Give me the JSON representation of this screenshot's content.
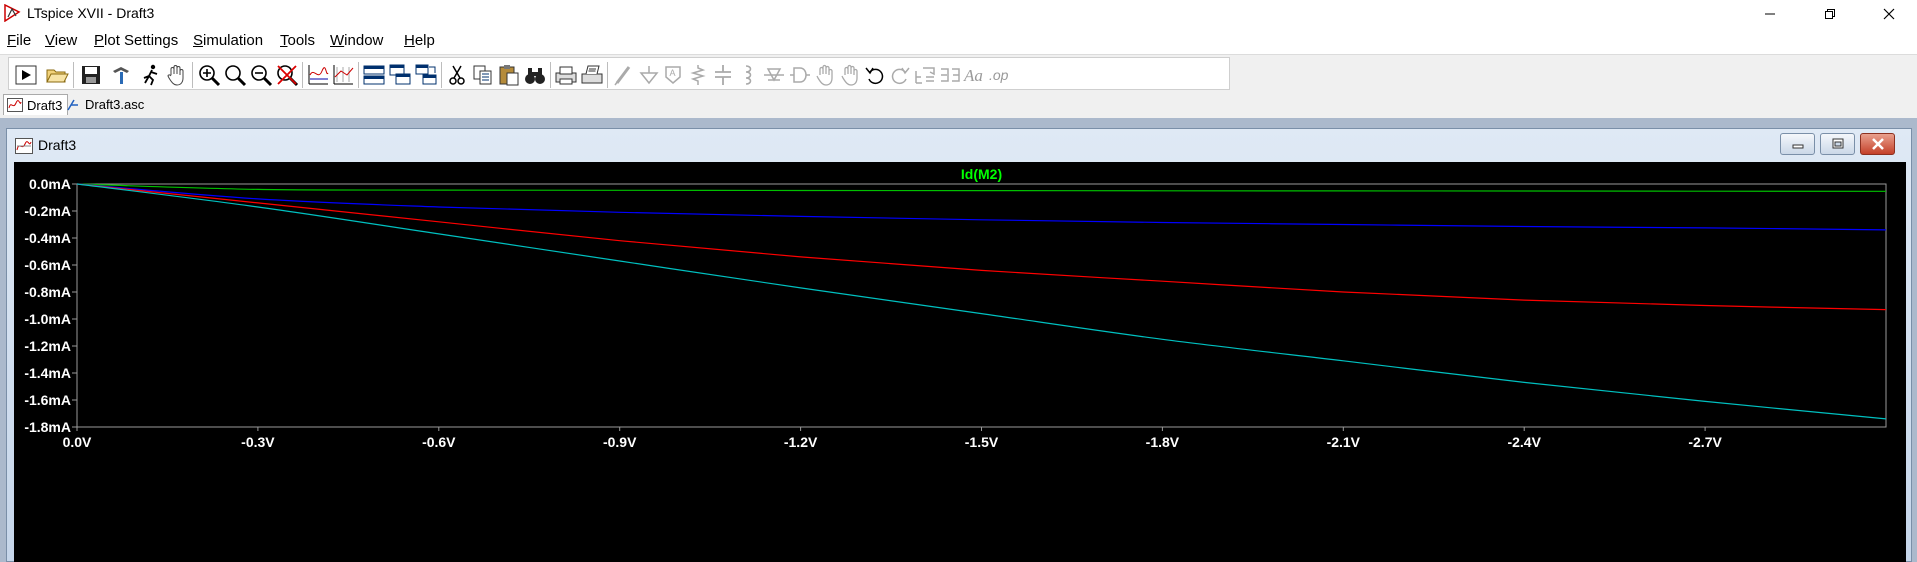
{
  "window": {
    "title": "LTspice XVII - Draft3",
    "app_icon": "ltspice-logo-icon",
    "controls": [
      "minimize-icon",
      "maximize-icon",
      "close-icon"
    ]
  },
  "menu": {
    "items": [
      {
        "label": "File",
        "key": "F"
      },
      {
        "label": "View",
        "key": "V"
      },
      {
        "label": "Plot Settings",
        "key": "P"
      },
      {
        "label": "Simulation",
        "key": "S"
      },
      {
        "label": "Tools",
        "key": "T"
      },
      {
        "label": "Window",
        "key": "W"
      },
      {
        "label": "Help",
        "key": "H"
      }
    ]
  },
  "toolbar": {
    "buttons": [
      "run-icon",
      "open-icon",
      "save-icon",
      "control-panel-icon",
      "halt-icon",
      "pan-icon",
      "zoom-in-icon",
      "zoom-area-icon",
      "zoom-out-icon",
      "zoom-cancel-icon",
      "autorange-icon",
      "pick-visible-traces-icon",
      "tile-horizontal-icon",
      "cascade-icon",
      "tile-vertical-icon",
      "cut-icon",
      "copy-icon",
      "paste-icon",
      "find-icon",
      "print-icon",
      "print-setup-icon",
      "draw-wire-icon",
      "ground-icon",
      "label-net-icon",
      "resistor-icon",
      "capacitor-icon",
      "inductor-icon",
      "diode-icon",
      "component-icon",
      "move-icon",
      "drag-icon",
      "undo-icon",
      "redo-icon",
      "rotate-icon",
      "mirror-icon",
      "text-icon",
      "spice-directive-icon"
    ]
  },
  "tabs": [
    {
      "label": "Draft3",
      "icon": "waveform-icon",
      "active": true
    },
    {
      "label": "Draft3.asc",
      "icon": "schematic-icon",
      "active": false
    }
  ],
  "plot_window": {
    "title": "Draft3",
    "icon": "waveform-icon",
    "controls": [
      "minimize-icon",
      "restore-icon",
      "close-icon"
    ]
  },
  "colors": {
    "plot_background": "#000000",
    "trace_green": "#00c000",
    "trace_blue": "#0000ff",
    "trace_red": "#ff0000",
    "trace_cyan": "#00c0c0",
    "trace_label": "#00ff00"
  },
  "chart_data": {
    "type": "line",
    "title": "Id(M2)",
    "xlabel": "",
    "ylabel": "",
    "xlim": [
      0.0,
      -3.0
    ],
    "ylim": [
      0.0,
      -1.8
    ],
    "x_ticks": [
      "0.0V",
      "-0.3V",
      "-0.6V",
      "-0.9V",
      "-1.2V",
      "-1.5V",
      "-1.8V",
      "-2.1V",
      "-2.4V",
      "-2.7V"
    ],
    "y_ticks": [
      "0.0mA",
      "-0.2mA",
      "-0.4mA",
      "-0.6mA",
      "-0.8mA",
      "-1.0mA",
      "-1.2mA",
      "-1.4mA",
      "-1.6mA",
      "-1.8mA"
    ],
    "grid": false,
    "x": [
      0.0,
      -0.3,
      -0.6,
      -0.9,
      -1.2,
      -1.5,
      -1.8,
      -2.1,
      -2.4,
      -2.7,
      -3.0
    ],
    "series": [
      {
        "color": "#00c000",
        "values": [
          0.0,
          -0.04,
          -0.045,
          -0.047,
          -0.048,
          -0.049,
          -0.05,
          -0.051,
          -0.052,
          -0.053,
          -0.054
        ]
      },
      {
        "color": "#0000ff",
        "values": [
          0.0,
          -0.11,
          -0.17,
          -0.21,
          -0.24,
          -0.265,
          -0.285,
          -0.3,
          -0.315,
          -0.325,
          -0.34
        ]
      },
      {
        "color": "#ff0000",
        "values": [
          0.0,
          -0.14,
          -0.28,
          -0.42,
          -0.54,
          -0.64,
          -0.72,
          -0.8,
          -0.86,
          -0.9,
          -0.93
        ]
      },
      {
        "color": "#00c0c0",
        "values": [
          0.0,
          -0.17,
          -0.37,
          -0.57,
          -0.77,
          -0.96,
          -1.15,
          -1.31,
          -1.47,
          -1.61,
          -1.74
        ]
      }
    ]
  }
}
